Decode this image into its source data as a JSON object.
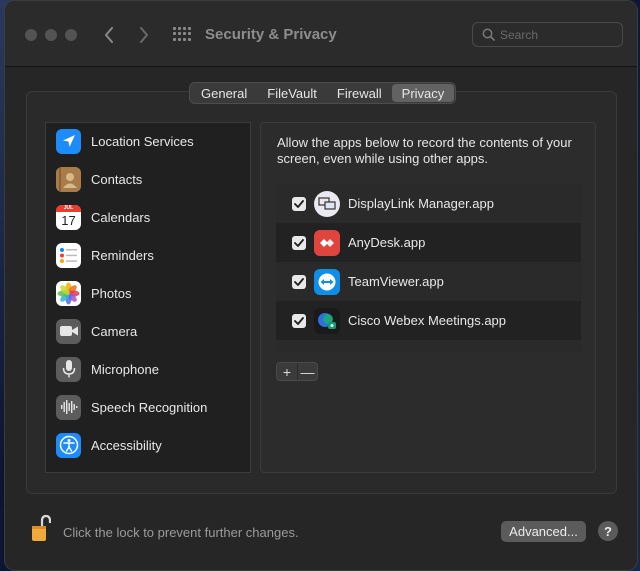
{
  "window": {
    "title": "Security & Privacy"
  },
  "search": {
    "placeholder": "Search"
  },
  "tabs": [
    {
      "label": "General"
    },
    {
      "label": "FileVault"
    },
    {
      "label": "Firewall"
    },
    {
      "label": "Privacy",
      "active": true
    }
  ],
  "sidebar": {
    "items": [
      {
        "label": "Location Services",
        "icon": "location-icon"
      },
      {
        "label": "Contacts",
        "icon": "contacts-icon"
      },
      {
        "label": "Calendars",
        "icon": "calendar-icon",
        "month": "JUL",
        "day": "17"
      },
      {
        "label": "Reminders",
        "icon": "reminders-icon"
      },
      {
        "label": "Photos",
        "icon": "photos-icon"
      },
      {
        "label": "Camera",
        "icon": "camera-icon"
      },
      {
        "label": "Microphone",
        "icon": "microphone-icon"
      },
      {
        "label": "Speech Recognition",
        "icon": "speech-recognition-icon"
      },
      {
        "label": "Accessibility",
        "icon": "accessibility-icon"
      }
    ]
  },
  "main": {
    "description": "Allow the apps below to record the contents of your screen, even while using other apps.",
    "apps": [
      {
        "name": "DisplayLink Manager.app",
        "checked": true,
        "icon": "displaylink-icon"
      },
      {
        "name": "AnyDesk.app",
        "checked": true,
        "icon": "anydesk-icon"
      },
      {
        "name": "TeamViewer.app",
        "checked": true,
        "icon": "teamviewer-icon"
      },
      {
        "name": "Cisco Webex Meetings.app",
        "checked": true,
        "icon": "webex-icon"
      }
    ],
    "add_label": "+",
    "remove_label": "—"
  },
  "footer": {
    "lock_text": "Click the lock to prevent further changes.",
    "advanced_label": "Advanced...",
    "help_label": "?"
  },
  "colors": {
    "window_bg": "#262626",
    "location_blue": "#1d8cf8",
    "anydesk_red": "#e0453d",
    "teamviewer_blue": "#0e8ee9",
    "lock_orange": "#f0a93b"
  }
}
